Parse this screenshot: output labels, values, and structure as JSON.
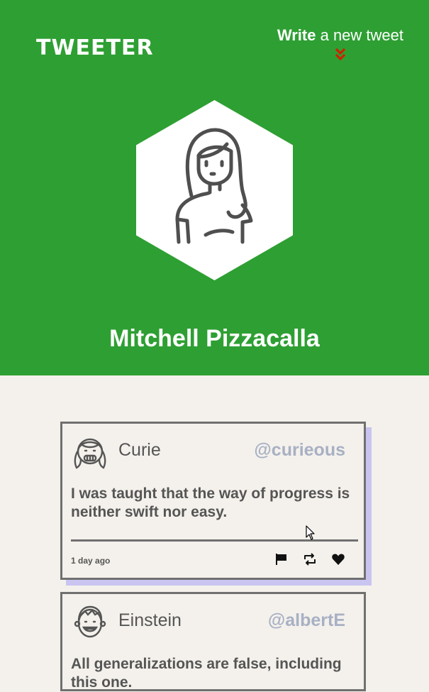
{
  "header": {
    "logo": "TWEETER",
    "compose_bold": "Write",
    "compose_rest": " a new tweet",
    "background_color": "#2e9f33",
    "chevron_color": "#cc2200",
    "chevron_icon": "double-chevron-down-icon"
  },
  "profile": {
    "name": "Mitchell Pizzacalla",
    "avatar_icon": "woman-avatar-icon"
  },
  "tweets": [
    {
      "name": "Curie",
      "handle": "@curieous",
      "text": "I was taught that the way of progress is neither swift nor easy.",
      "time": "1 day ago",
      "avatar_icon": "girl-avatar-icon",
      "actions": [
        "flag-icon",
        "retweet-icon",
        "heart-icon"
      ]
    },
    {
      "name": "Einstein",
      "handle": "@albertE",
      "text": "All generalizations are false, including this one.",
      "avatar_icon": "boy-avatar-icon"
    }
  ]
}
